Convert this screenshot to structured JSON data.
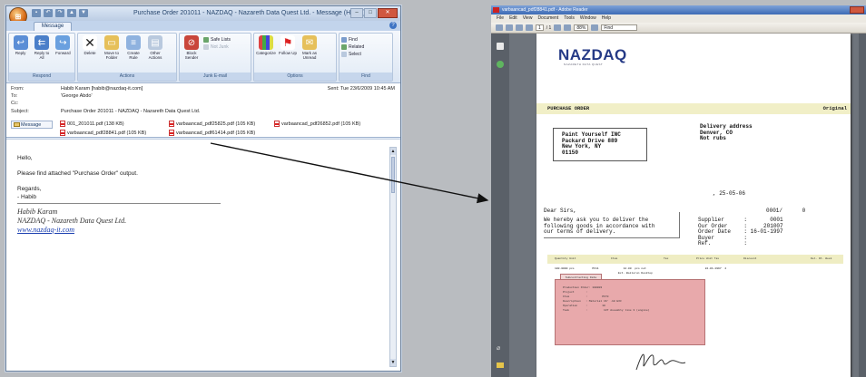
{
  "outlook": {
    "title": "Purchase Order 201011 - NAZDAQ - Nazareth Data Quest Ltd. - Message (HTML)",
    "orb_glyph": "⊞",
    "tab_message": "Message",
    "ribbon": {
      "respond": {
        "label": "Respond",
        "reply": "Reply",
        "reply_all": "Reply to All",
        "forward": "Forward"
      },
      "actions": {
        "label": "Actions",
        "delete": "Delete",
        "move_to_folder": "Move to Folder",
        "create_rule": "Create Rule",
        "other_actions": "Other Actions"
      },
      "junk": {
        "label": "Junk E-mail",
        "block_sender": "Block Sender",
        "safe_lists": "Safe Lists",
        "not_junk": "Not Junk"
      },
      "options": {
        "label": "Options",
        "categorize": "Categorize",
        "follow_up": "Follow Up",
        "mark_unread": "Mark as Unread"
      },
      "find": {
        "label": "Find",
        "find": "Find",
        "related": "Related",
        "select": "Select"
      }
    },
    "headers": {
      "from_label": "From:",
      "from_value": "Habib Karam [habib@nazdaq-it.com]",
      "to_label": "To:",
      "to_value": "'George Abdo'",
      "cc_label": "Cc:",
      "cc_value": "",
      "subject_label": "Subject:",
      "subject_value": "Purchase Order 201011 - NAZDAQ - Nazareth Data Quest Ltd.",
      "sent_label": "Sent:",
      "sent_value": "Tue 23/6/2009 10:45 AM"
    },
    "attachments": {
      "message_button": "Message",
      "items": [
        "001_201011.pdf (138 KB)",
        "varbaancad_pdf25825.pdf (105 KB)",
        "varbaancad_pdf26852.pdf (105 KB)",
        "varbaancad_pdf28841.pdf (105 KB)",
        "varbaancad_pdf61414.pdf (105 KB)"
      ]
    },
    "body": {
      "greeting": "Hello,",
      "line1": "Please find attached \"Purchase Order\" output.",
      "regards": "Regards,",
      "sender": "- Habib",
      "sig_name": "Habib Karam",
      "sig_company": "NAZDAQ - Nazareth Data Quest Ltd.",
      "sig_link": "www.nazdaq-it.com"
    }
  },
  "acrobat": {
    "title": "varbaancad_pdf28841.pdf - Adobe Reader",
    "menu": [
      "File",
      "Edit",
      "View",
      "Document",
      "Tools",
      "Window",
      "Help"
    ],
    "page_box": "1",
    "page_total": "/ 1",
    "zoom": "88%",
    "find_label": "Find",
    "doc": {
      "logo": "NAZDAQ",
      "logo_sub": "NAZARETH DATA QUEST",
      "po_title": "PURCHASE ORDER",
      "original": "Original",
      "address": "Paint Yourself INC\nPackard Drive 889\nNew York, NY\n01150",
      "delivery": "Delivery address\nDenver, CO\nNot rubs",
      "date_line": ", 25-05-06",
      "dear": "Dear Sirs,",
      "po_no": "0001/      0",
      "letter": "We hereby ask you to deliver the\nfollowing goods in accordance with\nour terms of delivery.",
      "fields": "Supplier      :       0001\nOur Order     :     201007\nOrder Date    : 16-01-1997\nBuyer         :\nRef.          :",
      "line_headers": [
        "Quantity  Unit",
        "Item",
        "Tax",
        "Price Unit  Tax",
        "Discount",
        "Del. Dt. Week"
      ],
      "line_row": "100.0000 pcs           PF11               12.00  pcs net                                    22-01-1997  4",
      "line_desc": "Ext. Boilerun Desktop",
      "pink_tab": "Subcontracting Data",
      "pink_text": "Production Order: 100003\nProject       :\nItem          :         PF70\nDescription   : Material 16' .10 EXC\nOperation     :         10\nTask          :          137 Assembly line 3 (engine)"
    }
  }
}
